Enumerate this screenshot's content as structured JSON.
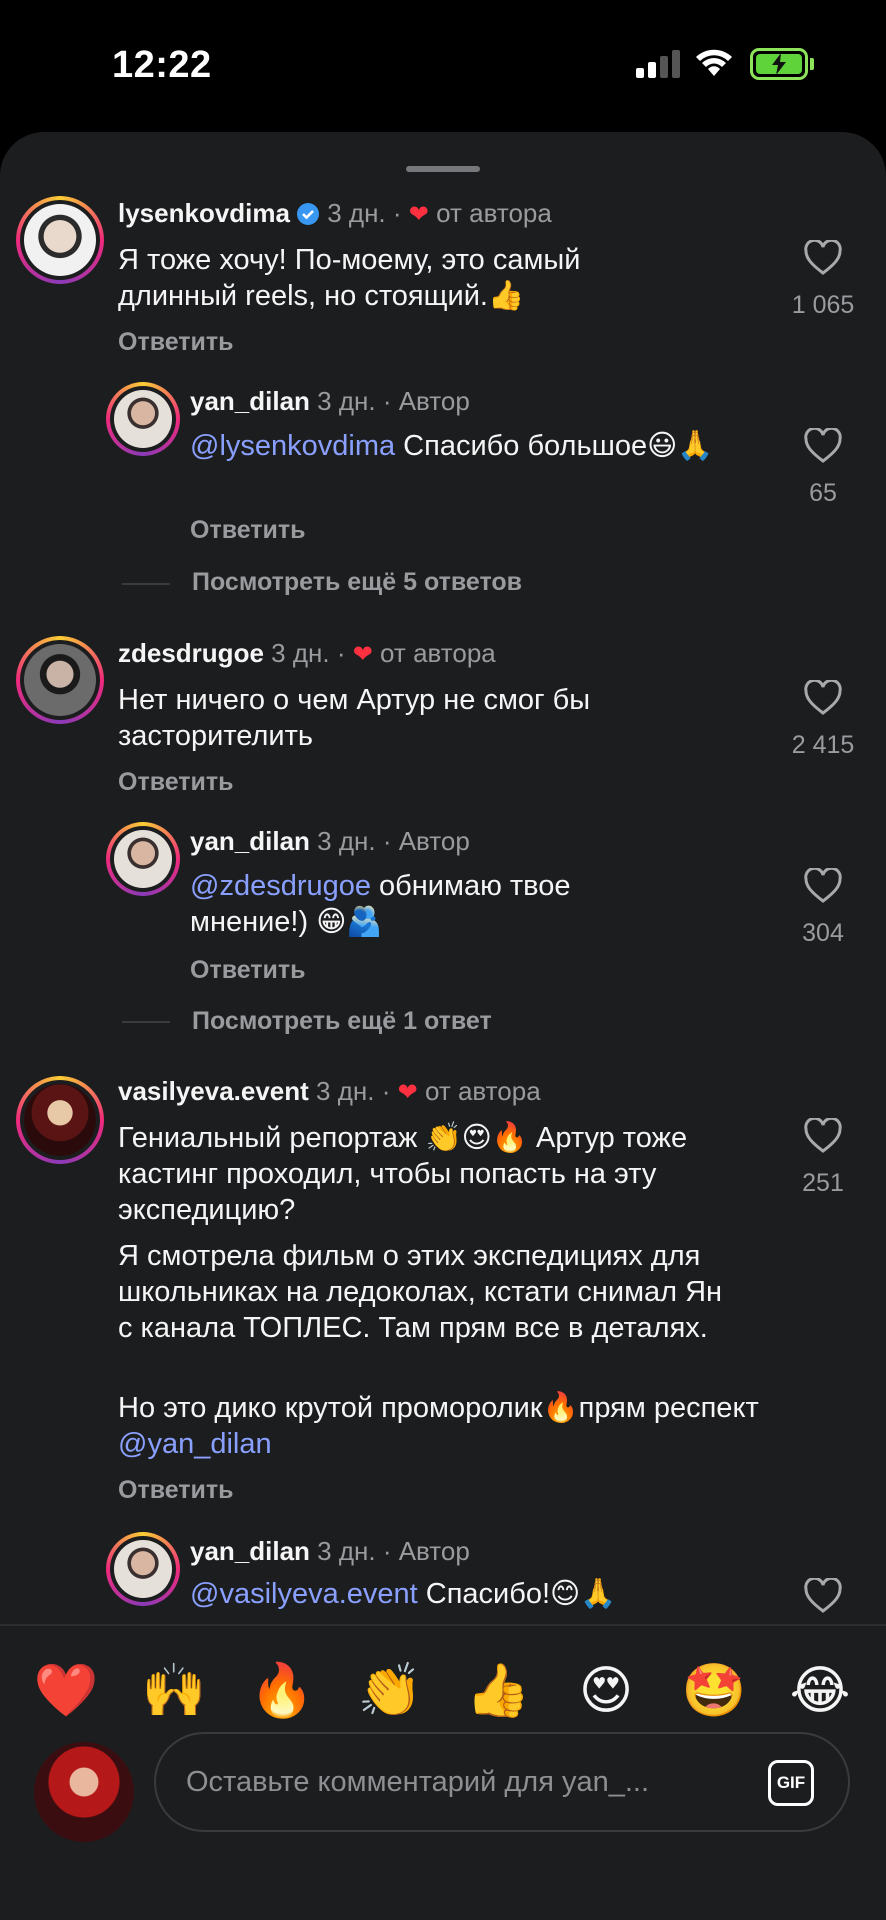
{
  "status_bar": {
    "time": "12:22"
  },
  "comments": [
    {
      "username": "lysenkovdima",
      "verified": true,
      "age": "3 дн.",
      "tag": "от автора",
      "text": "Я тоже хочу! По-моему, это самый длинный reels, но стоящий.👍",
      "reply_label": "Ответить",
      "likes": "1 065"
    },
    {
      "username": "yan_dilan",
      "age": "3 дн.",
      "tag": "Автор",
      "mention": "@lysenkovdima",
      "text": " Спасибо большое😃🙏",
      "reply_label": "Ответить",
      "likes": "65"
    },
    {
      "more_replies": "Посмотреть ещё 5 ответов"
    },
    {
      "username": "zdesdrugoe",
      "age": "3 дн.",
      "tag": "от автора",
      "text": "Нет ничего о чем Артур не смог бы засторителить",
      "reply_label": "Ответить",
      "likes": "2 415"
    },
    {
      "username": "yan_dilan",
      "age": "3 дн.",
      "tag": "Автор",
      "mention": "@zdesdrugoe",
      "text": " обнимаю твое мнение!) 😁🫂",
      "reply_label": "Ответить",
      "likes": "304"
    },
    {
      "more_replies": "Посмотреть ещё 1 ответ"
    },
    {
      "username": "vasilyeva.event",
      "age": "3 дн.",
      "tag": "от автора",
      "text_p1": "Гениальный репортаж 👏😍🔥 Артур тоже кастинг проходил, чтобы попасть на эту экспедицию?",
      "text_p2": "Я смотрела фильм о этих экспедициях для школьниках на ледоколах, кстати снимал Ян с канала ТОПЛЕС. Там прям все в деталях.",
      "text_p3": "Но это дико крутой проморолик🔥прям респект ",
      "mention": "@yan_dilan",
      "reply_label": "Ответить",
      "likes": "251"
    },
    {
      "username": "yan_dilan",
      "age": "3 дн.",
      "tag": "Автор",
      "mention": "@vasilyeva.event",
      "text": " Спасибо!😊🙏"
    }
  ],
  "emoji_bar": [
    "❤️",
    "🙌",
    "🔥",
    "👏",
    "👍",
    "😍",
    "🤩",
    "😂"
  ],
  "compose": {
    "placeholder": "Оставьте комментарий для yan_...",
    "gif_label": "GIF"
  },
  "colors": {
    "background": "#1c1d1f",
    "mention": "#8aa0ff",
    "heart": "#ff3040",
    "muted": "#9a9b9e"
  }
}
